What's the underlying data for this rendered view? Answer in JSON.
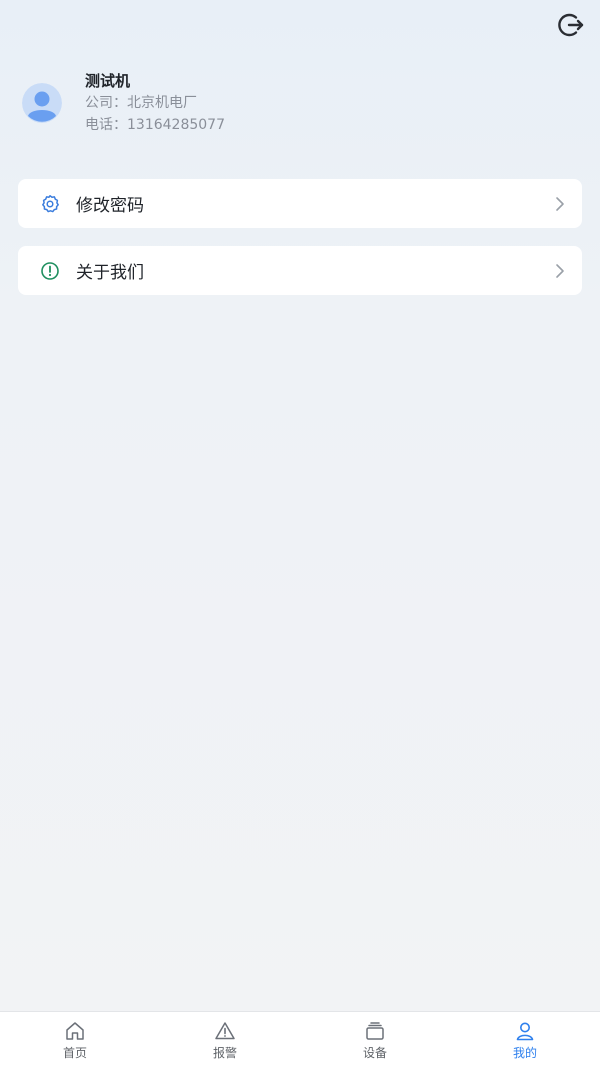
{
  "profile": {
    "name": "测试机",
    "company": "公司：北京机电厂",
    "phone": "电话：13164285077"
  },
  "menu": [
    {
      "label": "修改密码",
      "icon": "gear-icon"
    },
    {
      "label": "关于我们",
      "icon": "info-circle-icon"
    }
  ],
  "tabs": [
    {
      "label": "首页",
      "icon": "home-icon"
    },
    {
      "label": "报警",
      "icon": "warning-icon"
    },
    {
      "label": "设备",
      "icon": "device-icon"
    },
    {
      "label": "我的",
      "icon": "user-icon"
    }
  ],
  "colors": {
    "accent": "#2f80ed",
    "info_green": "#1f8f5f",
    "gear_blue": "#3b7ddd"
  }
}
